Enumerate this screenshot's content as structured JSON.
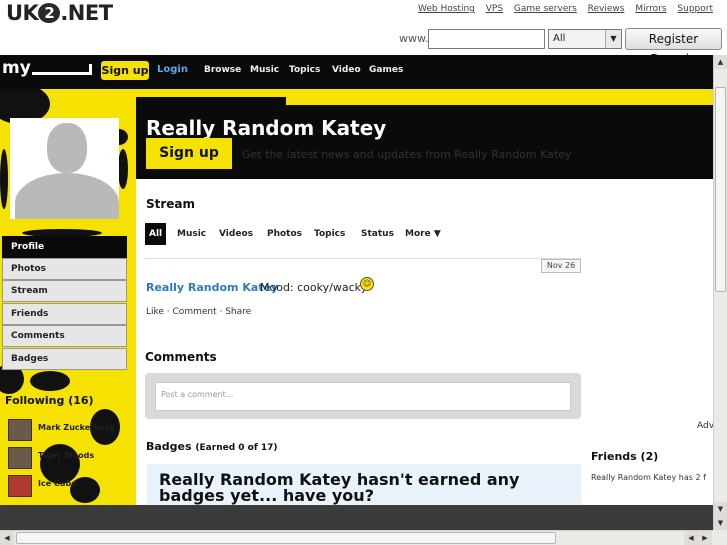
{
  "site": {
    "logo_text_left": "UK",
    "logo_text_mid": "2",
    "logo_text_right": ".NET",
    "top_links": [
      "Web Hosting",
      "VPS",
      "Game servers",
      "Reviews",
      "Mirrors",
      "Support"
    ],
    "domain": {
      "www_label": "www.",
      "input_value": "",
      "tld_selected": "All",
      "register_label": "Register Domain"
    }
  },
  "navbar": {
    "logo": "my",
    "signup_label": "Sign up",
    "login_label": "Login",
    "links": [
      "Browse",
      "Music",
      "Topics",
      "Video",
      "Games"
    ]
  },
  "sidebar": {
    "items": [
      "Profile",
      "Photos",
      "Stream",
      "Friends",
      "Comments",
      "Badges"
    ],
    "active_item": "Profile",
    "following_title": "Following (16)",
    "following": [
      {
        "name": "Mark Zuckerberg"
      },
      {
        "name": "Tiger Woods"
      },
      {
        "name": "Ice Cube"
      }
    ]
  },
  "banner": {
    "title": "Really Random Katey",
    "signup_label": "Sign up",
    "tagline": "Get the latest news and updates from Really Random Katey"
  },
  "stream": {
    "title": "Stream",
    "tabs": [
      "All",
      "Music",
      "Videos",
      "Photos",
      "Topics",
      "Status",
      "More ▼"
    ],
    "active_tab": "All",
    "post": {
      "date": "Nov 26",
      "author": "Really Random Katey",
      "mood": "Mood: cooky/wacky",
      "smiley": "☺",
      "actions": "Like  · Comment · Share"
    }
  },
  "comments": {
    "title": "Comments",
    "placeholder": "Post a comment..."
  },
  "badges": {
    "title": "Badges",
    "earned": "(Earned 0 of 17)",
    "message": "Really Random Katey hasn't earned any badges yet... have you?"
  },
  "right": {
    "adv": "Adv",
    "friends_title": "Friends (2)",
    "friends_text": "Really Random Katey has 2 f"
  },
  "colors": {
    "brand_yellow": "#f5e200",
    "nav_black": "#0a0a0a",
    "link_blue": "#2b7bc4"
  }
}
